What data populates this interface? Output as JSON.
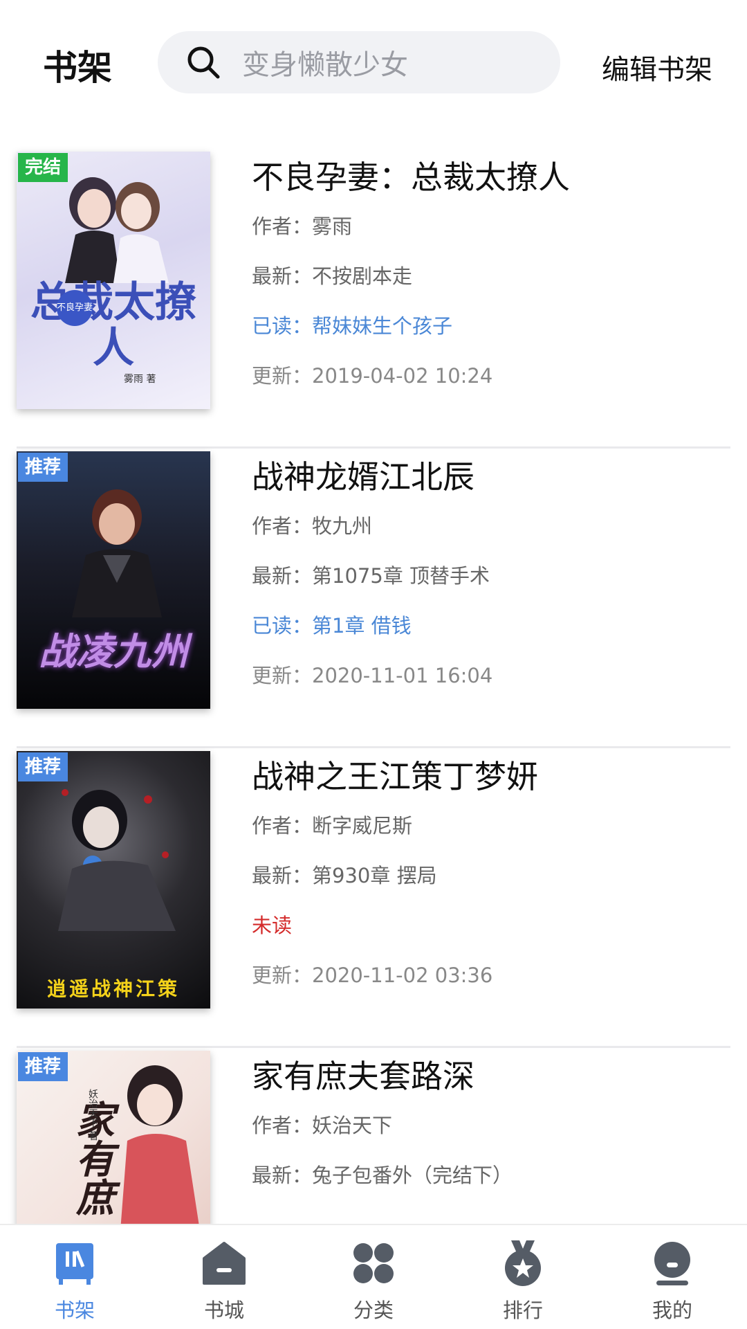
{
  "header": {
    "title": "书架",
    "search_placeholder": "变身懒散少女",
    "edit_label": "编辑书架"
  },
  "books": [
    {
      "title": "不良孕妻：总裁太撩人",
      "tag": "完结",
      "author": "作者：雾雨",
      "latest": "最新：不按剧本走",
      "read": "已读：帮妹妹生个孩子",
      "updated": "更新：2019-04-02 10:24",
      "cover_text": "总裁太撩人",
      "cover_badge": "不良孕妻",
      "cover_author": "雾雨 著"
    },
    {
      "title": "战神龙婿江北辰",
      "tag": "推荐",
      "author": "作者：牧九州",
      "latest": "最新：第1075章 顶替手术",
      "read": "已读：第1章 借钱",
      "updated": "更新：2020-11-01 16:04",
      "cover_text": "战凌九州"
    },
    {
      "title": "战神之王江策丁梦妍",
      "tag": "推荐",
      "author": "作者：断字威尼斯",
      "latest": "最新：第930章 摆局",
      "read": "未读",
      "updated": "更新：2020-11-02 03:36",
      "cover_text": "逍遥战神江策"
    },
    {
      "title": "家有庶夫套路深",
      "tag": "推荐",
      "author": "作者：妖治天下",
      "latest": "最新：兔子包番外（完结下）",
      "cover_text": "家有庶",
      "cover_author": "妖治天下 著"
    }
  ],
  "nav": {
    "items": [
      {
        "label": "书架",
        "icon": "bookshelf-icon",
        "active": true
      },
      {
        "label": "书城",
        "icon": "store-icon"
      },
      {
        "label": "分类",
        "icon": "category-icon"
      },
      {
        "label": "排行",
        "icon": "ranking-icon"
      },
      {
        "label": "我的",
        "icon": "profile-icon"
      }
    ]
  },
  "colors": {
    "accent": "#4a87e0",
    "tag_done": "#27b54a",
    "read_link": "#4a87d6",
    "unread": "#d42b2b",
    "nav_inactive": "#555555"
  }
}
